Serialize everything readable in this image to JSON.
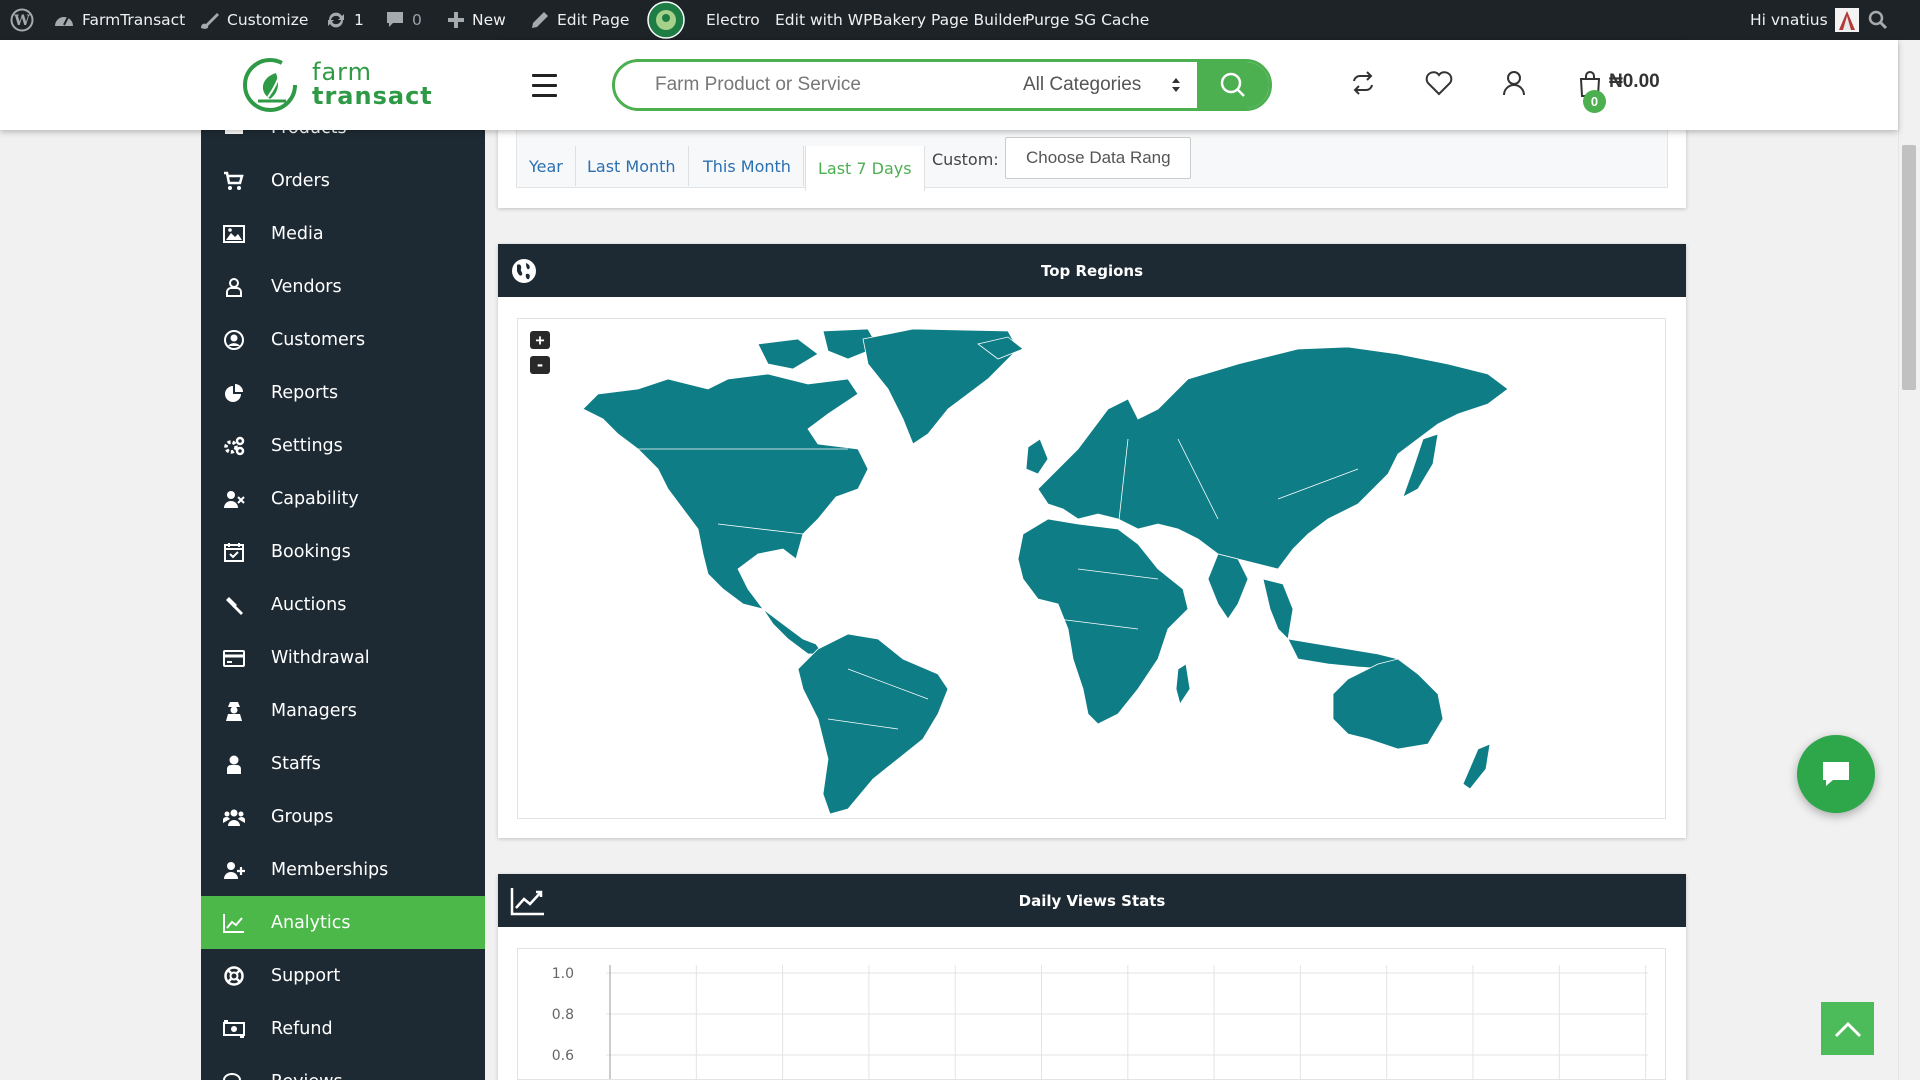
{
  "adminbar": {
    "site_name": "FarmTransact",
    "customize": "Customize",
    "updates": "1",
    "comments": "0",
    "new": "New",
    "edit_page": "Edit Page",
    "theme": "Electro",
    "wpbakery": "Edit with WPBakery Page Builder",
    "purge": "Purge SG Cache",
    "greeting": "Hi vnatius"
  },
  "header": {
    "logo_top": "farm",
    "logo_bottom": "transact",
    "search_placeholder": "Farm Product or Service",
    "category": "All Categories",
    "cart_count": "0",
    "cart_total": "₦0.00"
  },
  "sidebar": {
    "items": [
      {
        "label": "Products",
        "icon": "products-icon"
      },
      {
        "label": "Orders",
        "icon": "cart-icon"
      },
      {
        "label": "Media",
        "icon": "image-icon"
      },
      {
        "label": "Vendors",
        "icon": "user-outline-icon"
      },
      {
        "label": "Customers",
        "icon": "user-circle-icon"
      },
      {
        "label": "Reports",
        "icon": "pie-chart-icon"
      },
      {
        "label": "Settings",
        "icon": "cogs-icon"
      },
      {
        "label": "Capability",
        "icon": "user-times-icon"
      },
      {
        "label": "Bookings",
        "icon": "calendar-check-icon"
      },
      {
        "label": "Auctions",
        "icon": "gavel-icon"
      },
      {
        "label": "Withdrawal",
        "icon": "credit-card-icon"
      },
      {
        "label": "Managers",
        "icon": "user-secret-icon"
      },
      {
        "label": "Staffs",
        "icon": "user-icon"
      },
      {
        "label": "Groups",
        "icon": "users-icon"
      },
      {
        "label": "Memberships",
        "icon": "user-plus-icon"
      },
      {
        "label": "Analytics",
        "icon": "line-chart-icon",
        "active": true
      },
      {
        "label": "Support",
        "icon": "life-ring-icon"
      },
      {
        "label": "Refund",
        "icon": "money-icon"
      },
      {
        "label": "Reviews",
        "icon": "comments-icon"
      }
    ]
  },
  "filters": {
    "tabs": [
      "Year",
      "Last Month",
      "This Month",
      "Last 7 Days"
    ],
    "active_tab": "Last 7 Days",
    "custom_label": "Custom:",
    "range_placeholder": "Choose Data Range"
  },
  "map_card": {
    "title": "Top Regions",
    "zoom_in": "+",
    "zoom_out": "-",
    "fill_color": "#0e7d86"
  },
  "views_card": {
    "title": "Daily Views Stats"
  },
  "chart_data": {
    "type": "line",
    "title": "Daily Views Stats",
    "yticks": [
      "1.0",
      "0.8",
      "0.6"
    ],
    "series": [],
    "grid": true
  },
  "colors": {
    "brand_green": "#4caf50",
    "sidebar_bg": "#1e2a33",
    "active_bg": "#4bb849"
  }
}
